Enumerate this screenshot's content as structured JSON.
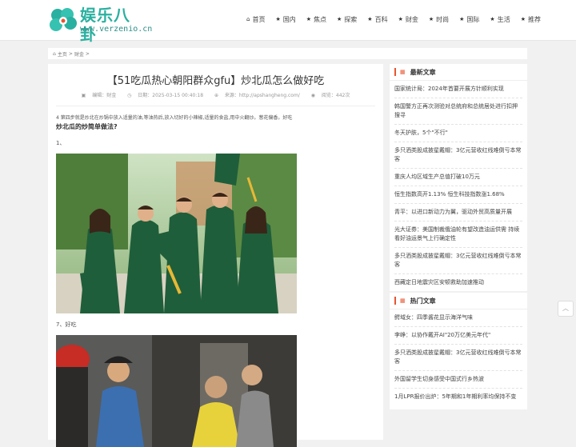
{
  "site": {
    "logo_cn": "娱乐八卦",
    "logo_en": "www.verzenio.cn"
  },
  "nav": [
    {
      "label": "首页",
      "icon": "home-icon"
    },
    {
      "label": "国内",
      "icon": "star-icon"
    },
    {
      "label": "焦点",
      "icon": "star-icon"
    },
    {
      "label": "探索",
      "icon": "star-icon"
    },
    {
      "label": "百科",
      "icon": "star-icon"
    },
    {
      "label": "财金",
      "icon": "star-icon"
    },
    {
      "label": "时尚",
      "icon": "star-icon"
    },
    {
      "label": "国际",
      "icon": "star-icon"
    },
    {
      "label": "生活",
      "icon": "star-icon"
    },
    {
      "label": "推荐",
      "icon": "star-icon"
    }
  ],
  "breadcrumb": {
    "home": "主页",
    "sep1": ">",
    "section": "财金",
    "sep2": ">"
  },
  "article": {
    "title": "【51吃瓜热心朝阳群众gfu】炒北瓜怎么做好吃",
    "meta_author": "编辑：财金",
    "meta_date": "日期：2025-03-15 00:40:18",
    "meta_source": "来源：http://apshangheng.com/",
    "meta_views": "阅览：442次",
    "para1": "4 第四步就是炒北在炒锅中放入适量的油,等油热后,放入切好的小辣椒,适量的食盐,用中火翻炒。葱花偏香。好吃",
    "para2": "炒北瓜的炒简单做法?",
    "para3": "1、",
    "para4": "7、好吃"
  },
  "sidebar": {
    "latest": {
      "title": "最新文章",
      "items": [
        "国家统计局：2024年首要开展方针顺利实现",
        "韩国警方正再次测验对总统府和总统居处进行扣押搜寻",
        "冬天护肤，5个\"不行\"",
        "多只洒类股成披星戴帽：3亿元营收红线难倒亏本常客",
        "重庆人均区域生产总值打破10万元",
        "恒生指数高开1.13% 恒生科技指数涨1.68%",
        "青平：以进口新动力为翼，驱动外贸高质量开展",
        "光大证券：美国制裁俄油轮有望改造油运供需 持续看好油运景气上行确定性",
        "多只洒类股成披星戴帽：3亿元营收红线难倒亏本常客",
        "西藏定日地震灾区安顿救助加速推动"
      ]
    },
    "hot": {
      "title": "热门文章",
      "items": [
        "鳄域女：四季酱花显示海洋气味",
        "李峥：以协作戴开AI\"20万亿美元年代\"",
        "多只洒类股成披星戴帽：3亿元营收红线难倒亏本常客",
        "外国留学生切身感受中国式行乡热波",
        "1月LPR报价出炉：5年期和1年期利率均保持不变"
      ]
    }
  },
  "colors": {
    "accent": "#e8542f",
    "logo": "#2ab0a0"
  }
}
